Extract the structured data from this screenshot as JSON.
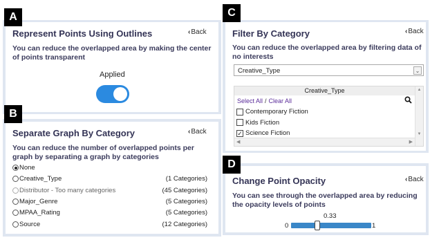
{
  "labels": {
    "a": "A",
    "b": "B",
    "c": "C",
    "d": "D"
  },
  "panel_a": {
    "title": "Represent Points Using Outlines",
    "back": "Back",
    "description": "You can reduce the overlapped area by making the center of points transparent",
    "applied_label": "Applied",
    "toggle_on": true
  },
  "panel_b": {
    "title": "Separate Graph By Category",
    "back": "Back",
    "description": "You can reduce the number of overlapped points per graph by separating a graph by categories",
    "options": [
      {
        "label": "None",
        "count": "",
        "checked": true,
        "disabled": false
      },
      {
        "label": "Creative_Type",
        "count": "(1 Categories)",
        "checked": false,
        "disabled": false
      },
      {
        "label": "Distributor - Too many categories",
        "count": "(45 Categories)",
        "checked": false,
        "disabled": true
      },
      {
        "label": "Major_Genre",
        "count": "(5 Categories)",
        "checked": false,
        "disabled": false
      },
      {
        "label": "MPAA_Rating",
        "count": "(5 Categories)",
        "checked": false,
        "disabled": false
      },
      {
        "label": "Source",
        "count": "(12 Categories)",
        "checked": false,
        "disabled": false
      }
    ]
  },
  "panel_c": {
    "title": "Filter By Category",
    "back": "Back",
    "description": "You can reduce the overlapped area by filtering data of no interests",
    "select_value": "Creative_Type",
    "list_header": "Creative_Type",
    "select_all": "Select All",
    "separator": "/",
    "clear_all": "Clear All",
    "items": [
      {
        "label": "Contemporary Fiction",
        "checked": false
      },
      {
        "label": "Kids Fiction",
        "checked": false
      },
      {
        "label": "Science Fiction",
        "checked": true
      }
    ]
  },
  "panel_d": {
    "title": "Change Point Opacity",
    "back": "Back",
    "description": "You can see through the overlapped area by reducing the opacity levels of points",
    "min_label": "0",
    "max_label": "1",
    "value": 0.33,
    "value_label": "0.33"
  },
  "icons": {
    "back": "chevron-left-icon",
    "search": "search-icon",
    "select_arrow": "chevron-down-icon"
  },
  "colors": {
    "toggle_on": "#2b8ae0",
    "slider": "#3a87c8",
    "panel_frame": "#dfe6f1",
    "link": "#5b2d9a"
  }
}
